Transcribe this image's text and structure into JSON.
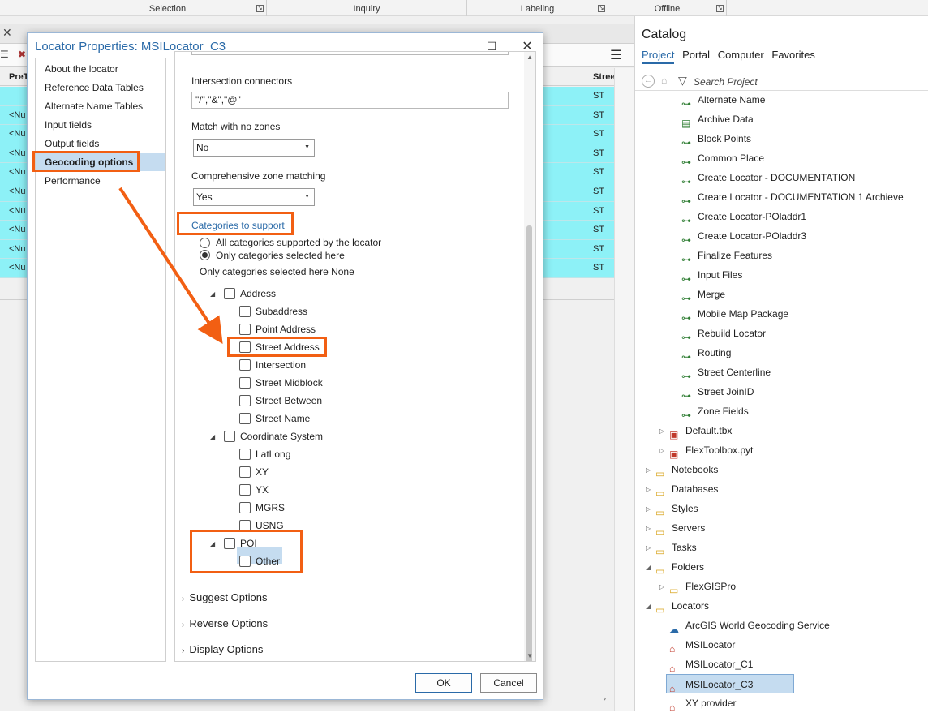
{
  "ribbon": {
    "groups": [
      {
        "label": "Selection"
      },
      {
        "label": "Inquiry"
      },
      {
        "label": "Labeling"
      },
      {
        "label": "Offline"
      }
    ]
  },
  "table": {
    "col_pret": "PreT",
    "col_street": "Stree",
    "rows": [
      {
        "pre": "",
        "street": "ST"
      },
      {
        "pre": "<Nu",
        "street": "ST"
      },
      {
        "pre": "<Nu",
        "street": "ST"
      },
      {
        "pre": "<Nu",
        "street": "ST"
      },
      {
        "pre": "<Nu",
        "street": "ST"
      },
      {
        "pre": "<Nu",
        "street": "ST"
      },
      {
        "pre": "<Nu",
        "street": "ST"
      },
      {
        "pre": "<Nu",
        "street": "ST"
      },
      {
        "pre": "<Nu",
        "street": "ST"
      },
      {
        "pre": "<Nu",
        "street": "ST"
      }
    ]
  },
  "dialog": {
    "title": "Locator Properties: MSILocator_C3",
    "nav": [
      "About the locator",
      "Reference Data Tables",
      "Alternate Name Tables",
      "Input fields",
      "Output fields",
      "Geocoding options",
      "Performance"
    ],
    "selected_nav": "Geocoding options",
    "intersection_connectors_label": "Intersection connectors",
    "intersection_connectors_value": "\"/\",\"&\",\"@\"",
    "match_no_zones_label": "Match with no zones",
    "match_no_zones_value": "No",
    "comprehensive_zone_label": "Comprehensive zone matching",
    "comprehensive_zone_value": "Yes",
    "categories_title": "Categories to support",
    "radio_all": "All categories supported by the locator",
    "radio_selected": "Only categories selected here",
    "selected_summary": "Only categories selected here None",
    "categories": {
      "address": "Address",
      "address_children": [
        "Subaddress",
        "Point Address",
        "Street Address",
        "Intersection",
        "Street Midblock",
        "Street Between",
        "Street Name"
      ],
      "coord": "Coordinate System",
      "coord_children": [
        "LatLong",
        "XY",
        "YX",
        "MGRS",
        "USNG"
      ],
      "poi": "POI",
      "poi_children": [
        "Other"
      ]
    },
    "sections": [
      "Suggest Options",
      "Reverse Options",
      "Display Options"
    ],
    "ok": "OK",
    "cancel": "Cancel"
  },
  "catalog": {
    "title": "Catalog",
    "tabs": [
      "Project",
      "Portal",
      "Computer",
      "Favorites"
    ],
    "active_tab": "Project",
    "search_placeholder": "Search Project",
    "tools": [
      "Alternate Name",
      "Archive Data",
      "Block Points",
      "Common Place",
      "Create Locator - DOCUMENTATION",
      "Create Locator - DOCUMENTATION 1 Archieve",
      "Create Locator-POladdr1",
      "Create Locator-POladdr3",
      "Finalize Features",
      "Input Files",
      "Merge",
      "Mobile Map Package",
      "Rebuild Locator",
      "Routing",
      "Street Centerline",
      "Street JoinID",
      "Zone Fields"
    ],
    "toolboxes": [
      "Default.tbx",
      "FlexToolbox.pyt"
    ],
    "folders": [
      "Notebooks",
      "Databases",
      "Styles",
      "Servers",
      "Tasks",
      "Folders"
    ],
    "folder_child": "FlexGISPro",
    "locators_label": "Locators",
    "locators": [
      "ArcGIS World Geocoding Service",
      "MSILocator",
      "MSILocator_C1",
      "MSILocator_C3",
      "XY provider"
    ],
    "selected_locator": "MSILocator_C3"
  },
  "colors": {
    "highlight": "#f25f13",
    "accent": "#2a6aa8",
    "row_cyan": "#8df1f7",
    "selection": "#c5dcf0"
  }
}
